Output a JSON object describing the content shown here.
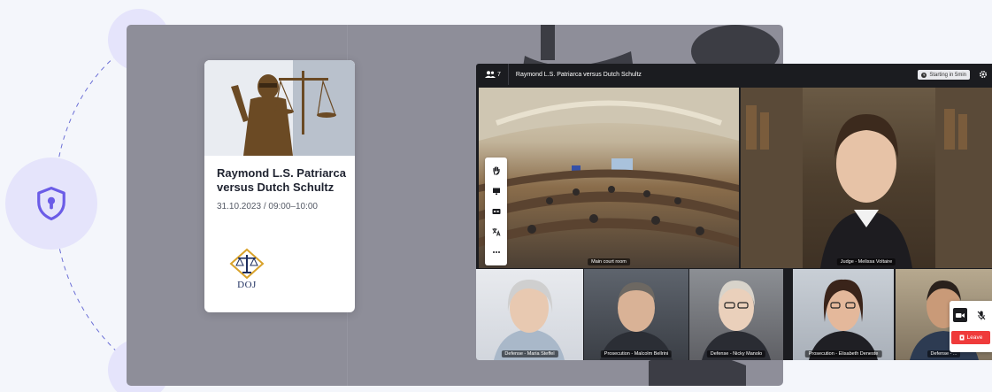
{
  "case_card": {
    "title": "Raymond L.S. Patriarca versus Dutch Schultz",
    "date": "31.10.2023 / 09:00–10:00",
    "logo_text": "DOJ"
  },
  "call": {
    "participant_count": "7",
    "title": "Raymond L.S. Patriarca versus Dutch Schultz",
    "status_badge": "Starting in 5min",
    "tiles": {
      "room": "Main court room",
      "judge": "Judge - Melissa Voltaire",
      "p1": "Defense - Maria Steffel",
      "p2": "Prosecution - Malcolm Bellrini",
      "p3": "Defense - Nicky Manolo",
      "p4": "Prosecution - Elisabeth Deneste",
      "p5": "Defense - ..."
    },
    "toolbar_icons": [
      "hand-icon",
      "screen-share-icon",
      "captions-icon",
      "translate-icon",
      "more-icon"
    ],
    "controls": {
      "leave_label": "Leave"
    }
  },
  "colors": {
    "accent_purple": "#6b5ce7",
    "badge_bg": "#e5e4fb",
    "leave_red": "#ef3b3b",
    "call_bg": "#1b1c20",
    "stage_bg": "#8e8e99"
  }
}
